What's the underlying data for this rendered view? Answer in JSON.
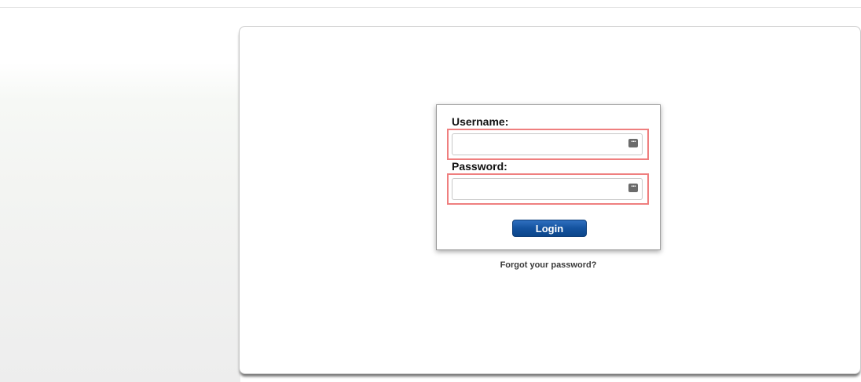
{
  "login_form": {
    "username_label": "Username:",
    "username_value": "",
    "password_label": "Password:",
    "password_value": "",
    "login_label": "Login",
    "forgot_password_label": "Forgot your password?"
  },
  "icons": {
    "username_autofill": "password-manager-autofill-icon",
    "password_autofill": "password-manager-autofill-icon"
  },
  "colors": {
    "highlight_border": "#ef7f7f",
    "login_button": "#14539f"
  }
}
